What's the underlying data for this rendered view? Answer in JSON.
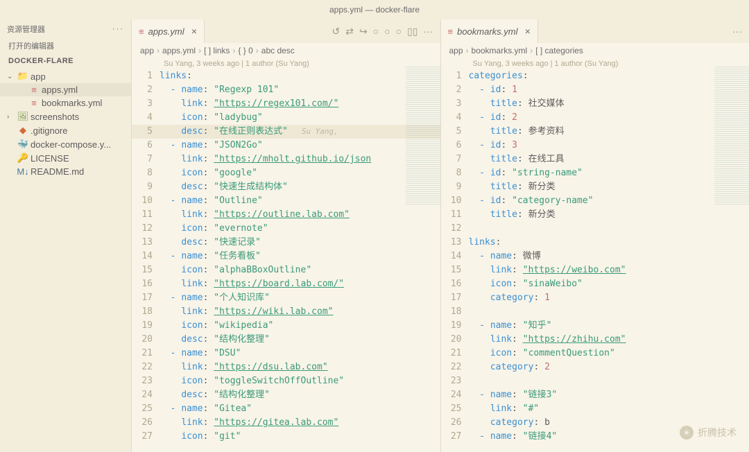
{
  "titlebar": "apps.yml — docker-flare",
  "sidebar": {
    "title": "资源管理器",
    "opened": "打开的编辑器",
    "project": "DOCKER-FLARE",
    "tree": [
      {
        "type": "folder",
        "name": "app",
        "open": true,
        "indent": 0
      },
      {
        "type": "yml",
        "name": "apps.yml",
        "indent": 1,
        "active": true
      },
      {
        "type": "yml",
        "name": "bookmarks.yml",
        "indent": 1
      },
      {
        "type": "img",
        "name": "screenshots",
        "indent": 0,
        "hasChev": true
      },
      {
        "type": "git",
        "name": ".gitignore",
        "indent": 0
      },
      {
        "type": "docker",
        "name": "docker-compose.y...",
        "indent": 0
      },
      {
        "type": "lic",
        "name": "LICENSE",
        "indent": 0
      },
      {
        "type": "md",
        "name": "README.md",
        "indent": 0
      }
    ]
  },
  "left": {
    "tab": "apps.yml",
    "breadcrumb": [
      "app",
      "apps.yml",
      "[ ] links",
      "{ } 0",
      "abc desc"
    ],
    "blame": "Su Yang, 3 weeks ago | 1 author (Su Yang)",
    "lines": [
      {
        "n": 1,
        "seg": [
          {
            "t": "links",
            "c": "key"
          },
          {
            "t": ":",
            "c": "punct"
          }
        ]
      },
      {
        "n": 2,
        "seg": [
          {
            "t": "  - ",
            "c": "dash"
          },
          {
            "t": "name",
            "c": "key"
          },
          {
            "t": ": ",
            "c": "punct"
          },
          {
            "t": "\"Regexp 101\"",
            "c": "str"
          }
        ]
      },
      {
        "n": 3,
        "seg": [
          {
            "t": "    ",
            "c": ""
          },
          {
            "t": "link",
            "c": "key"
          },
          {
            "t": ": ",
            "c": "punct"
          },
          {
            "t": "\"https://regex101.com/\"",
            "c": "str link"
          }
        ]
      },
      {
        "n": 4,
        "seg": [
          {
            "t": "    ",
            "c": ""
          },
          {
            "t": "icon",
            "c": "key"
          },
          {
            "t": ": ",
            "c": "punct"
          },
          {
            "t": "\"ladybug\"",
            "c": "str"
          }
        ]
      },
      {
        "n": 5,
        "hl": true,
        "seg": [
          {
            "t": "    ",
            "c": ""
          },
          {
            "t": "desc",
            "c": "key"
          },
          {
            "t": ": ",
            "c": "punct"
          },
          {
            "t": "\"在线正则表达式\"",
            "c": "str"
          }
        ],
        "blame": "Su Yang,"
      },
      {
        "n": 6,
        "seg": [
          {
            "t": "  - ",
            "c": "dash"
          },
          {
            "t": "name",
            "c": "key"
          },
          {
            "t": ": ",
            "c": "punct"
          },
          {
            "t": "\"JSON2Go\"",
            "c": "str"
          }
        ]
      },
      {
        "n": 7,
        "seg": [
          {
            "t": "    ",
            "c": ""
          },
          {
            "t": "link",
            "c": "key"
          },
          {
            "t": ": ",
            "c": "punct"
          },
          {
            "t": "\"https://mholt.github.io/json",
            "c": "str link"
          }
        ]
      },
      {
        "n": 8,
        "seg": [
          {
            "t": "    ",
            "c": ""
          },
          {
            "t": "icon",
            "c": "key"
          },
          {
            "t": ": ",
            "c": "punct"
          },
          {
            "t": "\"google\"",
            "c": "str"
          }
        ]
      },
      {
        "n": 9,
        "seg": [
          {
            "t": "    ",
            "c": ""
          },
          {
            "t": "desc",
            "c": "key"
          },
          {
            "t": ": ",
            "c": "punct"
          },
          {
            "t": "\"快速生成结构体\"",
            "c": "str"
          }
        ]
      },
      {
        "n": 10,
        "seg": [
          {
            "t": "  - ",
            "c": "dash"
          },
          {
            "t": "name",
            "c": "key"
          },
          {
            "t": ": ",
            "c": "punct"
          },
          {
            "t": "\"Outline\"",
            "c": "str"
          }
        ]
      },
      {
        "n": 11,
        "seg": [
          {
            "t": "    ",
            "c": ""
          },
          {
            "t": "link",
            "c": "key"
          },
          {
            "t": ": ",
            "c": "punct"
          },
          {
            "t": "\"https://outline.lab.com\"",
            "c": "str link"
          }
        ]
      },
      {
        "n": 12,
        "seg": [
          {
            "t": "    ",
            "c": ""
          },
          {
            "t": "icon",
            "c": "key"
          },
          {
            "t": ": ",
            "c": "punct"
          },
          {
            "t": "\"evernote\"",
            "c": "str"
          }
        ]
      },
      {
        "n": 13,
        "seg": [
          {
            "t": "    ",
            "c": ""
          },
          {
            "t": "desc",
            "c": "key"
          },
          {
            "t": ": ",
            "c": "punct"
          },
          {
            "t": "\"快速记录\"",
            "c": "str"
          }
        ]
      },
      {
        "n": 14,
        "seg": [
          {
            "t": "  - ",
            "c": "dash"
          },
          {
            "t": "name",
            "c": "key"
          },
          {
            "t": ": ",
            "c": "punct"
          },
          {
            "t": "\"任务看板\"",
            "c": "str"
          }
        ]
      },
      {
        "n": 15,
        "seg": [
          {
            "t": "    ",
            "c": ""
          },
          {
            "t": "icon",
            "c": "key"
          },
          {
            "t": ": ",
            "c": "punct"
          },
          {
            "t": "\"alphaBBoxOutline\"",
            "c": "str"
          }
        ]
      },
      {
        "n": 16,
        "seg": [
          {
            "t": "    ",
            "c": ""
          },
          {
            "t": "link",
            "c": "key"
          },
          {
            "t": ": ",
            "c": "punct"
          },
          {
            "t": "\"https://board.lab.com/\"",
            "c": "str link"
          }
        ]
      },
      {
        "n": 17,
        "seg": [
          {
            "t": "  - ",
            "c": "dash"
          },
          {
            "t": "name",
            "c": "key"
          },
          {
            "t": ": ",
            "c": "punct"
          },
          {
            "t": "\"个人知识库\"",
            "c": "str"
          }
        ]
      },
      {
        "n": 18,
        "seg": [
          {
            "t": "    ",
            "c": ""
          },
          {
            "t": "link",
            "c": "key"
          },
          {
            "t": ": ",
            "c": "punct"
          },
          {
            "t": "\"https://wiki.lab.com\"",
            "c": "str link"
          }
        ]
      },
      {
        "n": 19,
        "seg": [
          {
            "t": "    ",
            "c": ""
          },
          {
            "t": "icon",
            "c": "key"
          },
          {
            "t": ": ",
            "c": "punct"
          },
          {
            "t": "\"wikipedia\"",
            "c": "str"
          }
        ]
      },
      {
        "n": 20,
        "seg": [
          {
            "t": "    ",
            "c": ""
          },
          {
            "t": "desc",
            "c": "key"
          },
          {
            "t": ": ",
            "c": "punct"
          },
          {
            "t": "\"结构化整理\"",
            "c": "str"
          }
        ]
      },
      {
        "n": 21,
        "seg": [
          {
            "t": "  - ",
            "c": "dash"
          },
          {
            "t": "name",
            "c": "key"
          },
          {
            "t": ": ",
            "c": "punct"
          },
          {
            "t": "\"DSU\"",
            "c": "str"
          }
        ]
      },
      {
        "n": 22,
        "seg": [
          {
            "t": "    ",
            "c": ""
          },
          {
            "t": "link",
            "c": "key"
          },
          {
            "t": ": ",
            "c": "punct"
          },
          {
            "t": "\"https://dsu.lab.com\"",
            "c": "str link"
          }
        ]
      },
      {
        "n": 23,
        "seg": [
          {
            "t": "    ",
            "c": ""
          },
          {
            "t": "icon",
            "c": "key"
          },
          {
            "t": ": ",
            "c": "punct"
          },
          {
            "t": "\"toggleSwitchOffOutline\"",
            "c": "str"
          }
        ]
      },
      {
        "n": 24,
        "seg": [
          {
            "t": "    ",
            "c": ""
          },
          {
            "t": "desc",
            "c": "key"
          },
          {
            "t": ": ",
            "c": "punct"
          },
          {
            "t": "\"结构化整理\"",
            "c": "str"
          }
        ]
      },
      {
        "n": 25,
        "seg": [
          {
            "t": "  - ",
            "c": "dash"
          },
          {
            "t": "name",
            "c": "key"
          },
          {
            "t": ": ",
            "c": "punct"
          },
          {
            "t": "\"Gitea\"",
            "c": "str"
          }
        ]
      },
      {
        "n": 26,
        "seg": [
          {
            "t": "    ",
            "c": ""
          },
          {
            "t": "link",
            "c": "key"
          },
          {
            "t": ": ",
            "c": "punct"
          },
          {
            "t": "\"https://gitea.lab.com\"",
            "c": "str link"
          }
        ]
      },
      {
        "n": 27,
        "seg": [
          {
            "t": "    ",
            "c": ""
          },
          {
            "t": "icon",
            "c": "key"
          },
          {
            "t": ": ",
            "c": "punct"
          },
          {
            "t": "\"git\"",
            "c": "str"
          }
        ]
      }
    ]
  },
  "right": {
    "tab": "bookmarks.yml",
    "breadcrumb": [
      "app",
      "bookmarks.yml",
      "[ ] categories"
    ],
    "blame": "Su Yang, 3 weeks ago | 1 author (Su Yang)",
    "lines": [
      {
        "n": 1,
        "seg": [
          {
            "t": "categories",
            "c": "key"
          },
          {
            "t": ":",
            "c": "punct"
          }
        ]
      },
      {
        "n": 2,
        "seg": [
          {
            "t": "  - ",
            "c": "dash"
          },
          {
            "t": "id",
            "c": "key"
          },
          {
            "t": ": ",
            "c": "punct"
          },
          {
            "t": "1",
            "c": "num"
          }
        ]
      },
      {
        "n": 3,
        "seg": [
          {
            "t": "    ",
            "c": ""
          },
          {
            "t": "title",
            "c": "key"
          },
          {
            "t": ": ",
            "c": "punct"
          },
          {
            "t": "社交媒体",
            "c": "punct"
          }
        ]
      },
      {
        "n": 4,
        "seg": [
          {
            "t": "  - ",
            "c": "dash"
          },
          {
            "t": "id",
            "c": "key"
          },
          {
            "t": ": ",
            "c": "punct"
          },
          {
            "t": "2",
            "c": "num"
          }
        ]
      },
      {
        "n": 5,
        "seg": [
          {
            "t": "    ",
            "c": ""
          },
          {
            "t": "title",
            "c": "key"
          },
          {
            "t": ": ",
            "c": "punct"
          },
          {
            "t": "参考资料",
            "c": "punct"
          }
        ]
      },
      {
        "n": 6,
        "seg": [
          {
            "t": "  - ",
            "c": "dash"
          },
          {
            "t": "id",
            "c": "key"
          },
          {
            "t": ": ",
            "c": "punct"
          },
          {
            "t": "3",
            "c": "num"
          }
        ]
      },
      {
        "n": 7,
        "seg": [
          {
            "t": "    ",
            "c": ""
          },
          {
            "t": "title",
            "c": "key"
          },
          {
            "t": ": ",
            "c": "punct"
          },
          {
            "t": "在线工具",
            "c": "punct"
          }
        ]
      },
      {
        "n": 8,
        "seg": [
          {
            "t": "  - ",
            "c": "dash"
          },
          {
            "t": "id",
            "c": "key"
          },
          {
            "t": ": ",
            "c": "punct"
          },
          {
            "t": "\"string-name\"",
            "c": "str"
          }
        ]
      },
      {
        "n": 9,
        "seg": [
          {
            "t": "    ",
            "c": ""
          },
          {
            "t": "title",
            "c": "key"
          },
          {
            "t": ": ",
            "c": "punct"
          },
          {
            "t": "新分类",
            "c": "punct"
          }
        ]
      },
      {
        "n": 10,
        "seg": [
          {
            "t": "  - ",
            "c": "dash"
          },
          {
            "t": "id",
            "c": "key"
          },
          {
            "t": ": ",
            "c": "punct"
          },
          {
            "t": "\"category-name\"",
            "c": "str"
          }
        ]
      },
      {
        "n": 11,
        "seg": [
          {
            "t": "    ",
            "c": ""
          },
          {
            "t": "title",
            "c": "key"
          },
          {
            "t": ": ",
            "c": "punct"
          },
          {
            "t": "新分类",
            "c": "punct"
          }
        ]
      },
      {
        "n": 12,
        "seg": []
      },
      {
        "n": 13,
        "seg": [
          {
            "t": "links",
            "c": "key"
          },
          {
            "t": ":",
            "c": "punct"
          }
        ]
      },
      {
        "n": 14,
        "seg": [
          {
            "t": "  - ",
            "c": "dash"
          },
          {
            "t": "name",
            "c": "key"
          },
          {
            "t": ": ",
            "c": "punct"
          },
          {
            "t": "微博",
            "c": "punct"
          }
        ]
      },
      {
        "n": 15,
        "seg": [
          {
            "t": "    ",
            "c": ""
          },
          {
            "t": "link",
            "c": "key"
          },
          {
            "t": ": ",
            "c": "punct"
          },
          {
            "t": "\"https://weibo.com\"",
            "c": "str link"
          }
        ]
      },
      {
        "n": 16,
        "seg": [
          {
            "t": "    ",
            "c": ""
          },
          {
            "t": "icon",
            "c": "key"
          },
          {
            "t": ": ",
            "c": "punct"
          },
          {
            "t": "\"sinaWeibo\"",
            "c": "str"
          }
        ]
      },
      {
        "n": 17,
        "seg": [
          {
            "t": "    ",
            "c": ""
          },
          {
            "t": "category",
            "c": "key"
          },
          {
            "t": ": ",
            "c": "punct"
          },
          {
            "t": "1",
            "c": "num"
          }
        ]
      },
      {
        "n": 18,
        "seg": []
      },
      {
        "n": 19,
        "seg": [
          {
            "t": "  - ",
            "c": "dash"
          },
          {
            "t": "name",
            "c": "key"
          },
          {
            "t": ": ",
            "c": "punct"
          },
          {
            "t": "\"知乎\"",
            "c": "str"
          }
        ]
      },
      {
        "n": 20,
        "seg": [
          {
            "t": "    ",
            "c": ""
          },
          {
            "t": "link",
            "c": "key"
          },
          {
            "t": ": ",
            "c": "punct"
          },
          {
            "t": "\"https://zhihu.com\"",
            "c": "str link"
          }
        ]
      },
      {
        "n": 21,
        "seg": [
          {
            "t": "    ",
            "c": ""
          },
          {
            "t": "icon",
            "c": "key"
          },
          {
            "t": ": ",
            "c": "punct"
          },
          {
            "t": "\"commentQuestion\"",
            "c": "str"
          }
        ]
      },
      {
        "n": 22,
        "seg": [
          {
            "t": "    ",
            "c": ""
          },
          {
            "t": "category",
            "c": "key"
          },
          {
            "t": ": ",
            "c": "punct"
          },
          {
            "t": "2",
            "c": "num"
          }
        ]
      },
      {
        "n": 23,
        "seg": []
      },
      {
        "n": 24,
        "seg": [
          {
            "t": "  - ",
            "c": "dash"
          },
          {
            "t": "name",
            "c": "key"
          },
          {
            "t": ": ",
            "c": "punct"
          },
          {
            "t": "\"链接3\"",
            "c": "str"
          }
        ]
      },
      {
        "n": 25,
        "seg": [
          {
            "t": "    ",
            "c": ""
          },
          {
            "t": "link",
            "c": "key"
          },
          {
            "t": ": ",
            "c": "punct"
          },
          {
            "t": "\"#\"",
            "c": "str"
          }
        ]
      },
      {
        "n": 26,
        "seg": [
          {
            "t": "    ",
            "c": ""
          },
          {
            "t": "category",
            "c": "key"
          },
          {
            "t": ": ",
            "c": "punct"
          },
          {
            "t": "b",
            "c": "punct"
          }
        ]
      },
      {
        "n": 27,
        "seg": [
          {
            "t": "  - ",
            "c": "dash"
          },
          {
            "t": "name",
            "c": "key"
          },
          {
            "t": ": ",
            "c": "punct"
          },
          {
            "t": "\"链接4\"",
            "c": "str"
          }
        ]
      }
    ]
  },
  "icons": {
    "folder": "📁",
    "yml": "≡",
    "img": "🖼",
    "git": "◆",
    "docker": "🐳",
    "lic": "🔑",
    "md": "M↓",
    "close": "×",
    "dots": "···",
    "chev_down": "⌄",
    "chev_right": "›",
    "sep": "›",
    "history": "↺",
    "arrow": "↪",
    "split": "▯▯",
    "circle": "○",
    "compare": "⇄",
    "more": "···"
  },
  "watermark": "折腾技术"
}
